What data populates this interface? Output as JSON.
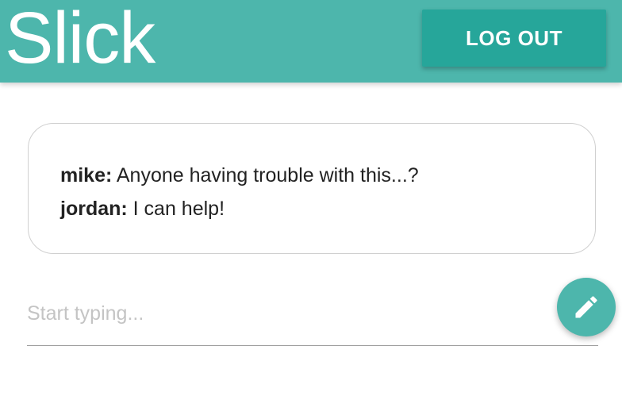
{
  "header": {
    "app_title": "Slick",
    "logout_label": "LOG OUT",
    "background_color": "#4db6ac",
    "button_color": "#26a69a"
  },
  "messages": [
    {
      "author": "mike:",
      "text": " Anyone having trouble with this...?"
    },
    {
      "author": "jordan:",
      "text": " I can help!"
    }
  ],
  "composer": {
    "placeholder": "Start typing...",
    "value": "",
    "send_icon": "pencil-icon"
  }
}
